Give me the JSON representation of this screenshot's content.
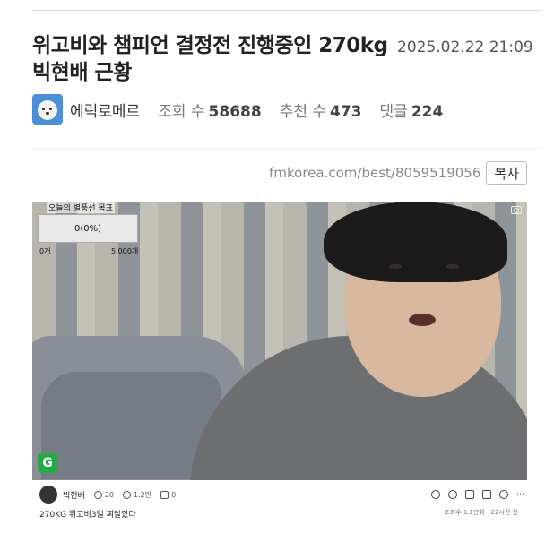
{
  "post": {
    "title": "위고비와 챔피언 결정전 진행중인 270kg 빅현배 근황",
    "date": "2025.02.22 21:09"
  },
  "author": {
    "name": "에릭로메르",
    "views_label": "조회 수",
    "views": "58688",
    "recommend_label": "추천 수",
    "recommend": "473",
    "comments_label": "댓글",
    "comments": "224"
  },
  "link": {
    "url": "fmkorea.com/best/8059519056",
    "copy_label": "복사"
  },
  "video": {
    "goal_title": "오늘의 별풍선 목표",
    "goal_value": "0(0%)",
    "goal_min": "0개",
    "goal_max": "5,000개",
    "badge": "G"
  },
  "clip": {
    "streamer": "빅현배",
    "stat1": "20",
    "stat2": "1.2만",
    "stat3": "0",
    "caption": "270KG 위고비3일 찌달았다",
    "meta": "조회수 1.1만회 · 22시간 전"
  },
  "colors": {
    "accent_badge": "#22aa44",
    "avatar_bg": "#4a90d9"
  }
}
